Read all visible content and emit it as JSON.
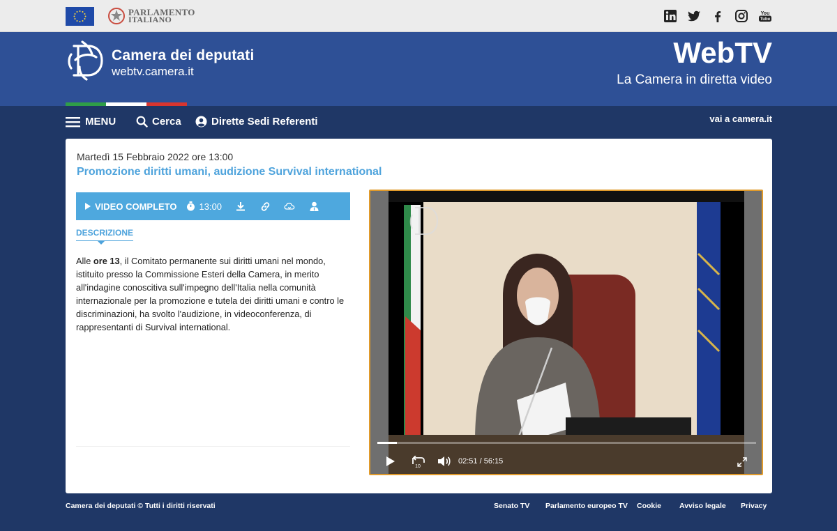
{
  "topbar": {
    "parliament_line1": "PARLAMENTO",
    "parliament_line2": "ITALIANO",
    "social_icons": [
      "linkedin-icon",
      "twitter-icon",
      "facebook-icon",
      "instagram-icon",
      "youtube-icon"
    ]
  },
  "header": {
    "site_title": "Camera dei deputati",
    "site_url": "webtv.camera.it",
    "brand": "WebTV",
    "tagline": "La Camera in diretta video",
    "colors": {
      "band": "#2e5096",
      "tricolor": [
        "#2f9e48",
        "#ffffff",
        "#d9352f"
      ]
    }
  },
  "nav": {
    "menu": "MENU",
    "search": "Cerca",
    "dirette": "Dirette Sedi Referenti",
    "external": "vai a camera.it"
  },
  "event": {
    "date": "Martedì 15 Febbraio 2022 ore 13:00",
    "title": "Promozione diritti umani, audizione Survival international",
    "toolbar": {
      "video_label": "VIDEO COMPLETO",
      "time": "13:00",
      "icons": [
        "download-icon",
        "link-icon",
        "cloud-icon",
        "user-icon"
      ]
    },
    "tab_label": "DESCRIZIONE",
    "description_pre": "Alle ",
    "description_bold": "ore 13",
    "description_post": ", il Comitato permanente sui diritti umani nel mondo, istituito presso la Commissione Esteri della Camera, in merito all'indagine conoscitiva sull'impegno dell'Italia nella comunità internazionale per la promozione e tutela dei diritti umani e contro le discriminazioni, ha svolto l'audizione, in videoconferenza, di rappresentanti di Survival international."
  },
  "player": {
    "current_time": "02:51",
    "separator": "/",
    "duration": "56:15",
    "progress_fraction": 0.051,
    "accent": "#e09a2b"
  },
  "footer": {
    "copyright": "Camera dei deputati © Tutti i diritti riservati",
    "links": [
      "Senato TV",
      "Parlamento europeo TV",
      "Cookie",
      "Avviso legale",
      "Privacy"
    ]
  }
}
